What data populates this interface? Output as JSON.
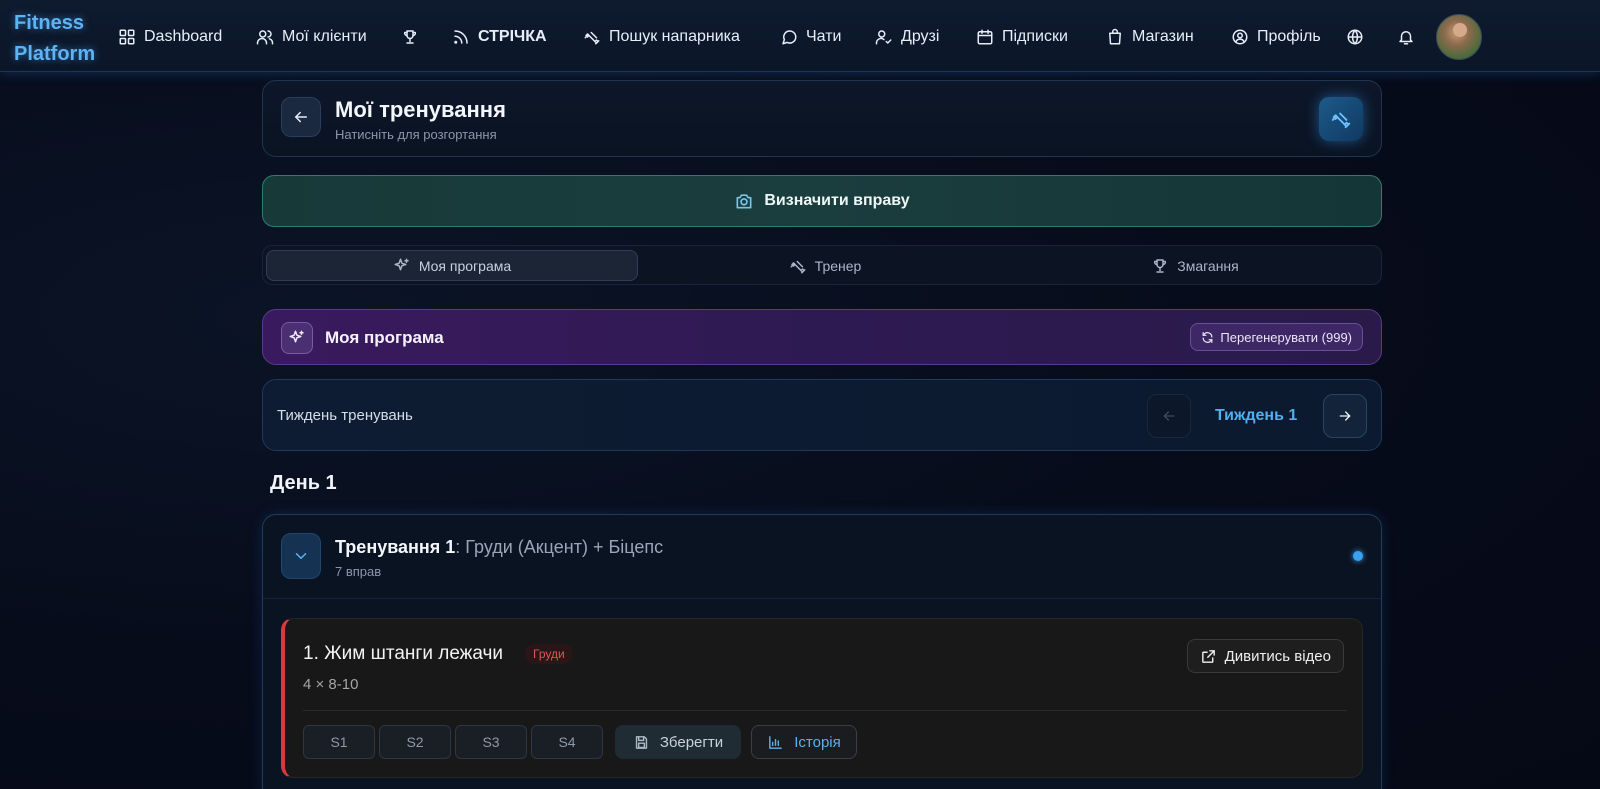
{
  "nav": {
    "logo": "Fitness Platform",
    "items": [
      {
        "label": "Dashboard",
        "icon": "grid-icon"
      },
      {
        "label": "Мої клієнти",
        "icon": "users-icon"
      },
      {
        "label": "",
        "icon": "trophy-icon"
      },
      {
        "label": "СТРІЧКА",
        "icon": "rss-icon"
      },
      {
        "label": "Пошук напарника",
        "icon": "dumbbell-icon"
      },
      {
        "label": "Чати",
        "icon": "chat-icon"
      },
      {
        "label": "Друзі",
        "icon": "user-check-icon"
      },
      {
        "label": "Підписки",
        "icon": "calendar-icon"
      },
      {
        "label": "Магазин",
        "icon": "shopping-bag-icon"
      },
      {
        "label": "Профіль",
        "icon": "user-circle-icon"
      }
    ]
  },
  "header": {
    "title": "Мої тренування",
    "subtitle": "Натисніть для розгортання"
  },
  "detect": {
    "label": "Визначити вправу"
  },
  "tabs": [
    {
      "label": "Моя програма",
      "active": true
    },
    {
      "label": "Тренер",
      "active": false
    },
    {
      "label": "Змагання",
      "active": false
    }
  ],
  "program": {
    "title": "Моя програма",
    "regenerate_label": "Перегенерувати (999)"
  },
  "week": {
    "label": "Тиждень тренувань",
    "current": "Тиждень 1"
  },
  "day": {
    "title": "День 1"
  },
  "workout": {
    "name": "Тренування 1",
    "focus": ": Груди (Акцент) + Біцепс",
    "count": "7 вправ",
    "exercise": {
      "name": "1. Жим штанги лежачи",
      "muscle": "Груди",
      "sets": "4 × 8-10",
      "video_label": "Дивитись відео",
      "set_labels": [
        "S1",
        "S2",
        "S3",
        "S4"
      ],
      "save_label": "Зберегти",
      "history_label": "Історія"
    }
  },
  "colors": {
    "accent": "#4fb0f0",
    "program": "#3a1a5e",
    "muscle_tag": "#e15656"
  }
}
